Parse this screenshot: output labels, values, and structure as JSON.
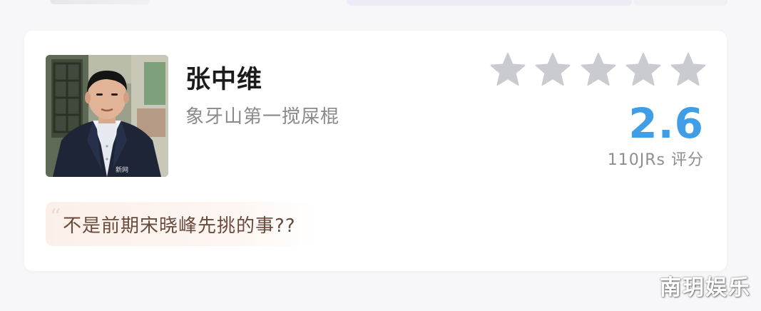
{
  "card": {
    "name": "张中维",
    "subtitle": "象牙山第一搅屎棍",
    "score": "2.6",
    "rating_count": "110JRs 评分",
    "stars": {
      "filled": 0,
      "total": 5,
      "color": "#c9cbd1"
    },
    "accent_color": "#3f9ee6",
    "avatar_caption": "新网"
  },
  "comment": {
    "text": "不是前期宋晓峰先挑的事??"
  },
  "watermark": "南玥娱乐"
}
